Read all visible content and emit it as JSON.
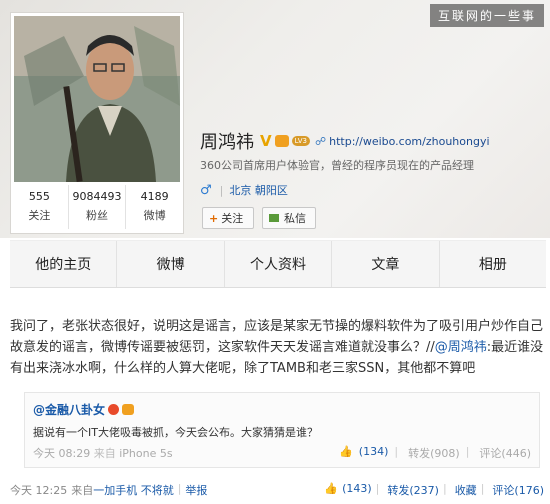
{
  "watermark": "互联网的一些事",
  "profile": {
    "name": "周鸿祎",
    "v_badge": "V",
    "level_badge": "LV3",
    "homepage_url": "http://weibo.com/zhouhongyi",
    "description": "360公司首席用户体验官，曾经的程序员现在的产品经理",
    "gender_symbol": "♂",
    "location": "北京 朝阳区",
    "follow_label": "关注",
    "message_label": "私信"
  },
  "stats": [
    {
      "number": "555",
      "label": "关注"
    },
    {
      "number": "9084493",
      "label": "粉丝"
    },
    {
      "number": "4189",
      "label": "微博"
    }
  ],
  "tabs": [
    "他的主页",
    "微博",
    "个人资料",
    "文章",
    "相册"
  ],
  "post": {
    "text_1": "我问了，老张状态很好，说明这是谣言，应该是某家无节操的爆料软件为了吸引用户炒作自己故意发的谣言，微博传谣要被惩罚，这家软件天天发谣言难道就没事么？//",
    "mention": "@周鸿祎",
    "text_2": ":最近谁没有出来浇冰水啊，什么样的人算大佬呢，除了TAMB和老三家SSN，其他都不算吧"
  },
  "repost": {
    "author": "@金融八卦女",
    "text": "据说有一个IT大佬吸毒被抓，今天会公布。大家猜猜是谁？",
    "time": "今天 08:29",
    "from_label": "来自",
    "source": "iPhone 5s",
    "like_count": "(134)",
    "repost_label": "转发(908)",
    "comment_label": "评论(446)"
  },
  "footer": {
    "time": "今天 12:25",
    "from_label": "来自",
    "source": "一加手机 不将就",
    "report": "举报",
    "like_count": "(143)",
    "repost_label": "转发(237)",
    "collect_label": "收藏",
    "comment_label": "评论(176)"
  }
}
